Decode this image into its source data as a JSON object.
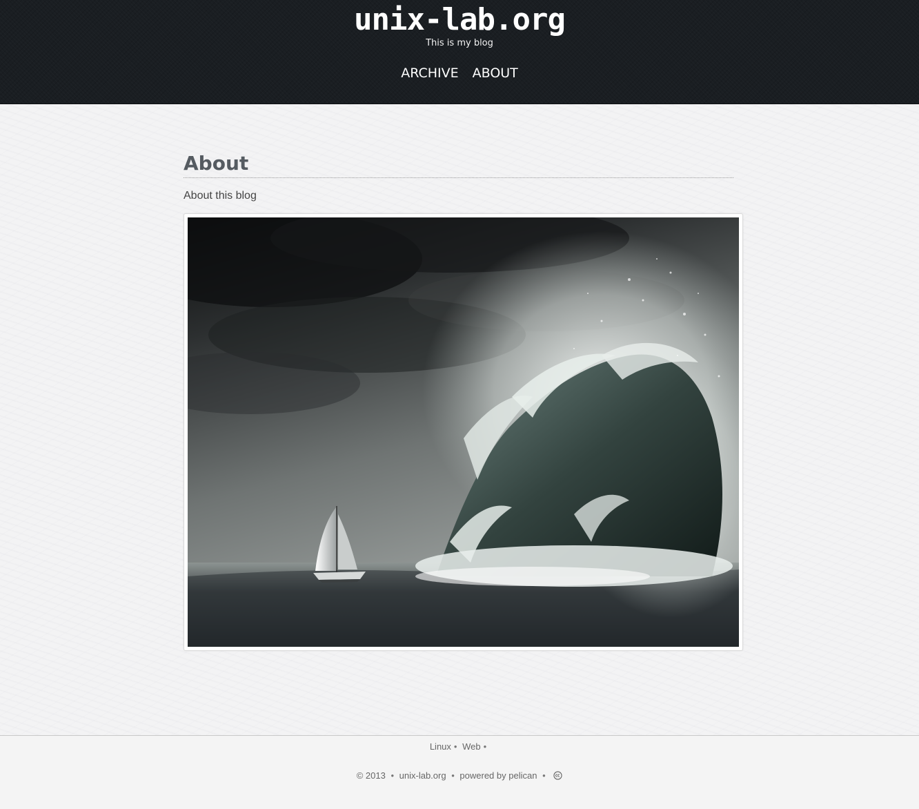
{
  "header": {
    "site_title": "unix-lab.org",
    "tagline": "This is my blog",
    "nav": [
      {
        "label": "ARCHIVE"
      },
      {
        "label": "ABOUT"
      }
    ]
  },
  "page": {
    "title": "About",
    "subtitle": "About this blog"
  },
  "footer": {
    "tags": [
      {
        "label": "Linux"
      },
      {
        "label": "Web"
      }
    ],
    "tag_separator": "•",
    "copyright_prefix": "© 2013",
    "separator": "•",
    "site_link": "unix-lab.org",
    "powered_by_text": "powered by",
    "powered_by_link": "pelican",
    "license_icon": "creative-commons-icon"
  },
  "colors": {
    "header_bg": "#1a1e22",
    "page_bg": "#f3f3f4",
    "title_text": "#555b61",
    "body_text": "#444444",
    "footer_bg": "#f4f4f4",
    "footer_text": "#666666"
  }
}
